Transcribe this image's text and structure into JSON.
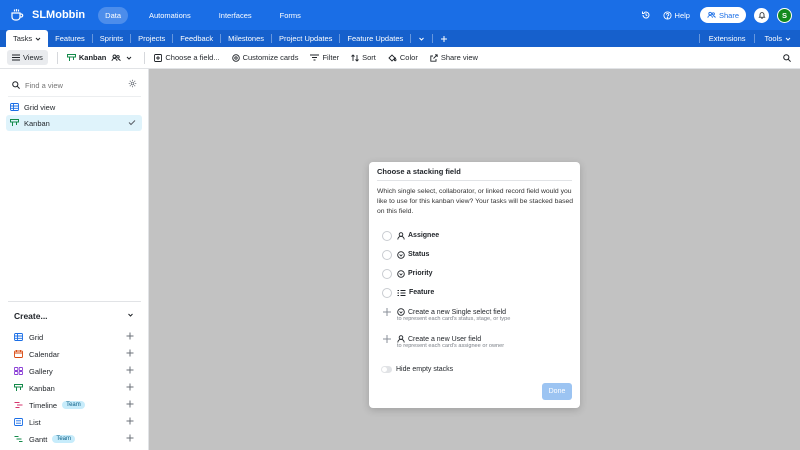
{
  "app": {
    "name": "SLMobbin"
  },
  "header": {
    "nav": [
      "Data",
      "Automations",
      "Interfaces",
      "Forms"
    ],
    "help_label": "Help",
    "share_label": "Share",
    "avatar_initial": "S"
  },
  "tables": {
    "active": "Tasks",
    "tabs": [
      "Features",
      "Sprints",
      "Projects",
      "Feedback",
      "Milestones",
      "Project Updates",
      "Feature Updates"
    ],
    "right": [
      "Extensions",
      "Tools"
    ]
  },
  "toolbar": {
    "views_label": "Views",
    "current_view": "Kanban",
    "choose_field": "Choose a field...",
    "customize": "Customize cards",
    "filter": "Filter",
    "sort": "Sort",
    "color": "Color",
    "share_view": "Share view"
  },
  "sidebar": {
    "find_placeholder": "Find a view",
    "views": [
      {
        "label": "Grid view"
      },
      {
        "label": "Kanban"
      }
    ],
    "create_heading": "Create...",
    "create_items": [
      {
        "label": "Grid"
      },
      {
        "label": "Calendar"
      },
      {
        "label": "Gallery"
      },
      {
        "label": "Kanban"
      },
      {
        "label": "Timeline",
        "badge": "Team"
      },
      {
        "label": "List"
      },
      {
        "label": "Gantt",
        "badge": "Team"
      }
    ]
  },
  "dialog": {
    "title": "Choose a stacking field",
    "description": "Which single select, collaborator, or linked record field would you like to use for this kanban view? Your tasks will be stacked based on this field.",
    "options": [
      "Assignee",
      "Status",
      "Priority",
      "Feature"
    ],
    "new_fields": [
      {
        "label": "Create a new Single select field",
        "sub": "to represent each card's status, stage, or type"
      },
      {
        "label": "Create a new User field",
        "sub": "to represent each card's assignee or owner"
      }
    ],
    "hide_empty": "Hide empty stacks",
    "done_label": "Done"
  },
  "colors": {
    "brand": "#1a6ee6",
    "tab_bar": "#1660cc",
    "done": "#9cc4f2",
    "selected_view": "#dff3fb"
  }
}
